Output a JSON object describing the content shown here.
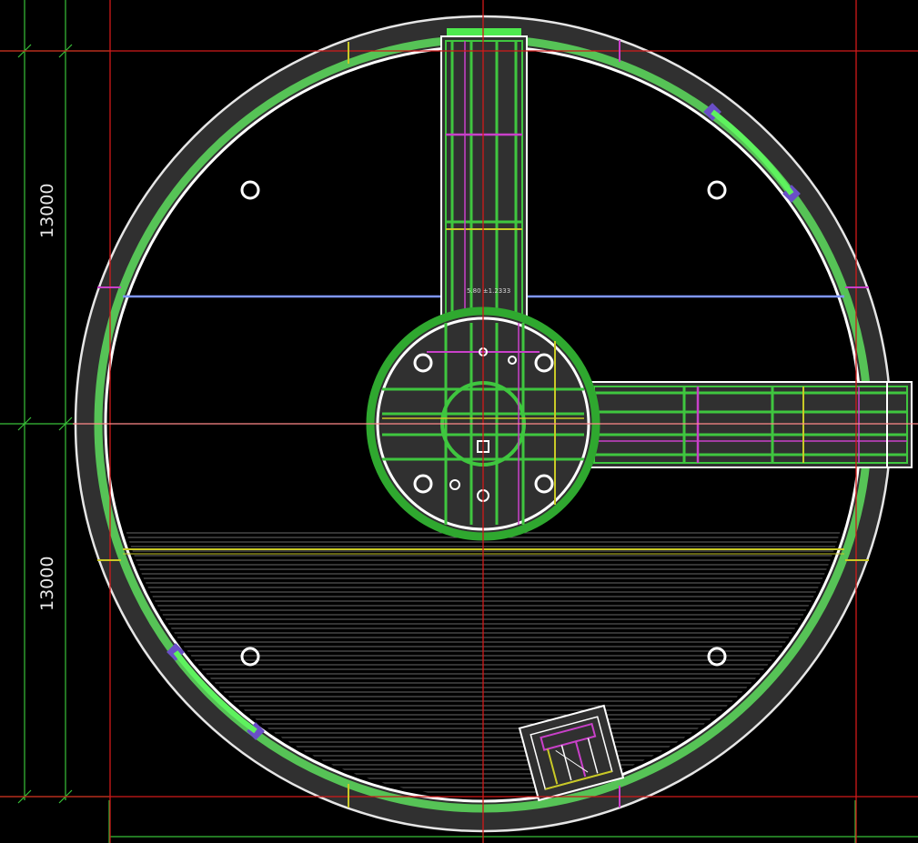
{
  "dimensions": {
    "upper_label": "13000",
    "lower_label": "13000"
  },
  "annotation_text": "5.80 ±1.2333",
  "colors": {
    "background": "#000000",
    "wall_fill": "#303030",
    "green": "#3fc63f",
    "bright_green": "#5ef25e",
    "white": "#ffffff",
    "red": "#d11a1a",
    "blue": "#7f97ff",
    "yellow": "#c9c926",
    "magenta": "#c940c9",
    "purple": "#6a4fc7"
  }
}
